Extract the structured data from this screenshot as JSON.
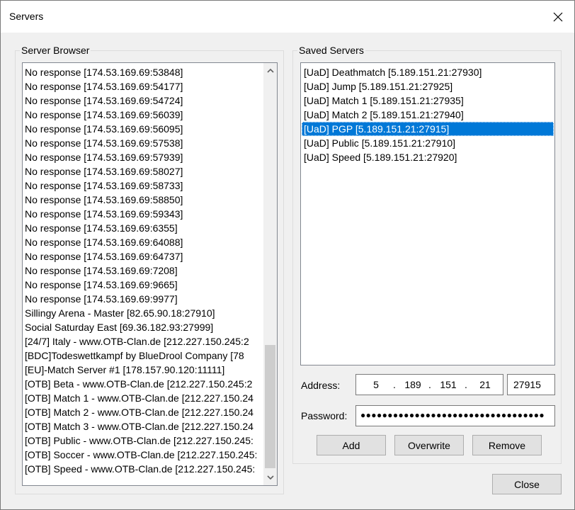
{
  "window": {
    "title": "Servers"
  },
  "server_browser": {
    "label": "Server Browser",
    "items": [
      "No response [174.53.169.69:53848]",
      "No response [174.53.169.69:54177]",
      "No response [174.53.169.69:54724]",
      "No response [174.53.169.69:56039]",
      "No response [174.53.169.69:56095]",
      "No response [174.53.169.69:57538]",
      "No response [174.53.169.69:57939]",
      "No response [174.53.169.69:58027]",
      "No response [174.53.169.69:58733]",
      "No response [174.53.169.69:58850]",
      "No response [174.53.169.69:59343]",
      "No response [174.53.169.69:6355]",
      "No response [174.53.169.69:64088]",
      "No response [174.53.169.69:64737]",
      "No response [174.53.169.69:7208]",
      "No response [174.53.169.69:9665]",
      "No response [174.53.169.69:9977]",
      "Sillingy Arena - Master [82.65.90.18:27910]",
      "Social Saturday East [69.36.182.93:27999]",
      "[24/7] Italy - www.OTB-Clan.de [212.227.150.245:2",
      "[BDC]Todeswettkampf by BlueDrool Company [78",
      "[EU]-Match Server #1 [178.157.90.120:11111]",
      "[OTB] Beta - www.OTB-Clan.de [212.227.150.245:2",
      "[OTB] Match 1 - www.OTB-Clan.de [212.227.150.24",
      "[OTB] Match 2 - www.OTB-Clan.de [212.227.150.24",
      "[OTB] Match 3 - www.OTB-Clan.de [212.227.150.24",
      "[OTB] Public - www.OTB-Clan.de [212.227.150.245:",
      "[OTB] Soccer - www.OTB-Clan.de [212.227.150.245:",
      "[OTB] Speed - www.OTB-Clan.de [212.227.150.245:"
    ]
  },
  "saved_servers": {
    "label": "Saved Servers",
    "items": [
      "[UaD] Deathmatch [5.189.151.21:27930]",
      "[UaD] Jump [5.189.151.21:27925]",
      "[UaD] Match 1 [5.189.151.21:27935]",
      "[UaD] Match 2 [5.189.151.21:27940]",
      "[UaD] PGP [5.189.151.21:27915]",
      "[UaD] Public [5.189.151.21:27910]",
      "[UaD] Speed [5.189.151.21:27920]"
    ],
    "selected_index": 4
  },
  "address": {
    "label": "Address:",
    "octets": [
      "5",
      "189",
      "151",
      "21"
    ],
    "port": "27915"
  },
  "password": {
    "label": "Password:",
    "masked_value": "●●●●●●●●●●●●●●●●●●●●●●●●●●●●●●●●●●"
  },
  "buttons": {
    "add": "Add",
    "overwrite": "Overwrite",
    "remove": "Remove",
    "close": "Close"
  },
  "colors": {
    "selection": "#0078d7",
    "window_bg": "#f0f0f0"
  }
}
